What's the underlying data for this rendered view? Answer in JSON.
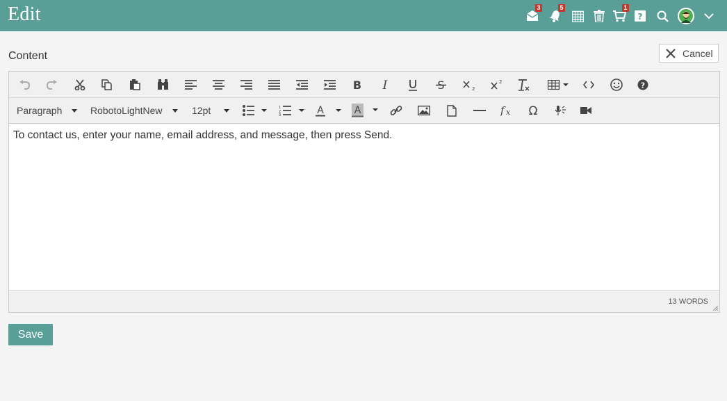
{
  "header": {
    "title": "Edit",
    "accent_color": "#5a9e98",
    "icons": [
      {
        "name": "mail-icon",
        "badge": "3"
      },
      {
        "name": "bell-icon",
        "badge": "5"
      },
      {
        "name": "calendar-icon"
      },
      {
        "name": "trash-icon"
      },
      {
        "name": "cart-icon",
        "badge": "1"
      },
      {
        "name": "help-icon"
      },
      {
        "name": "search-icon"
      },
      {
        "name": "avatar"
      },
      {
        "name": "chevron-down-icon"
      }
    ]
  },
  "form": {
    "content_label": "Content",
    "cancel_label": "Cancel",
    "save_label": "Save"
  },
  "editor": {
    "toolbar_row1": [
      "undo-icon",
      "redo-icon",
      "cut-icon",
      "copy-icon",
      "paste-icon",
      "find-icon",
      "align-left-icon",
      "align-center-icon",
      "align-right-icon",
      "justify-icon",
      "outdent-icon",
      "indent-icon",
      "bold-icon",
      "italic-icon",
      "underline-icon",
      "strikethrough-icon",
      "subscript-icon",
      "superscript-icon",
      "clear-formatting-icon",
      "table-icon",
      "source-code-icon",
      "emoticon-icon",
      "help-icon"
    ],
    "toolbar_row2": {
      "block_format": "Paragraph",
      "font_family": "RobotoLightNew",
      "font_size": "12pt",
      "buttons": [
        "bullet-list-icon",
        "numbered-list-icon",
        "text-color-icon",
        "background-color-icon",
        "link-icon",
        "image-icon",
        "document-icon",
        "horizontal-rule-icon",
        "formula-icon",
        "special-character-icon",
        "speech-icon",
        "video-icon"
      ]
    },
    "body_text": "To contact us, enter your name, email address, and message, then press Send.",
    "word_count": "13 WORDS"
  }
}
